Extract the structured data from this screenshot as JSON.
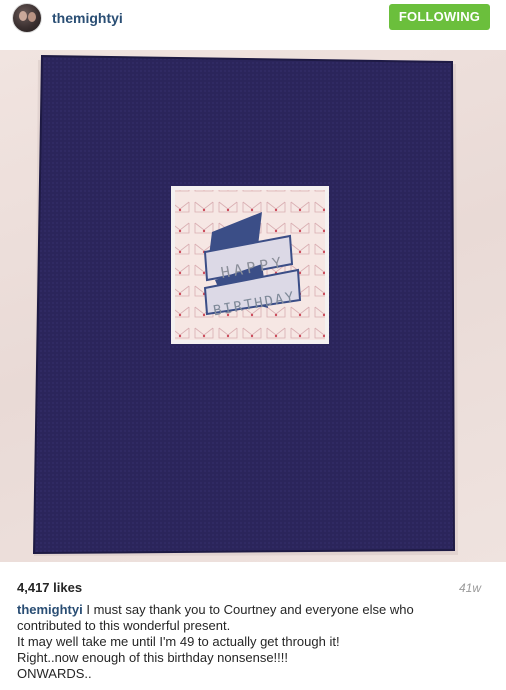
{
  "post": {
    "username": "themightyi",
    "follow_label": "FOLLOWING",
    "likes": "4,417 likes",
    "age": "41w",
    "caption_first_line": "I must say thank you to Courtney and everyone else who",
    "caption_lines": [
      "contributed to this wonderful present.",
      "It may well take me until I'm 49 to actually get through it!",
      "Right..now enough of this birthday nonsense!!!!",
      "ONWARDS.."
    ]
  },
  "photo": {
    "card_text_1": "HAPPY",
    "card_text_2": "BIRTHDAY"
  },
  "colors": {
    "follow_button": "#6bbf3c",
    "username_link": "#2a4e74",
    "book_cover": "#2a2459"
  }
}
